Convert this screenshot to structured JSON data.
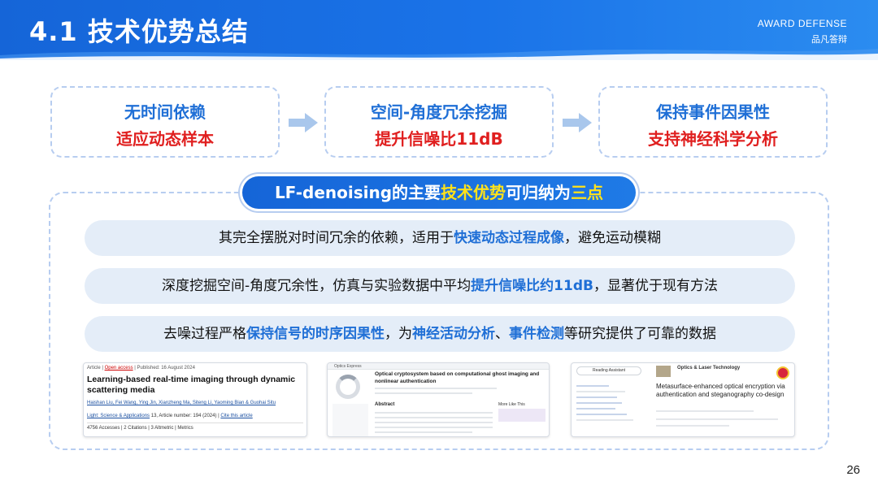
{
  "header": {
    "title": "4.1 技术优势总结",
    "brand_en": "AWARD DEFENSE",
    "brand_cn": "品凡答辩"
  },
  "cards": [
    {
      "line1": "无时间依赖",
      "line2": "适应动态样本"
    },
    {
      "line1": "空间-角度冗余挖掘",
      "line2": "提升信噪比11dB"
    },
    {
      "line1": "保持事件因果性",
      "line2": "支持神经科学分析"
    }
  ],
  "summary": {
    "prefix": "LF-denoising的主要",
    "hl1": "技术优势",
    "mid": "可归纳为",
    "hl2": "三点"
  },
  "points": [
    {
      "a": "其完全摆脱对时间冗余的依赖，适用于",
      "b": "快速动态过程成像",
      "c": "，避免运动模糊"
    },
    {
      "a": "深度挖掘空间-角度冗余性，仿真与实验数据中平均",
      "b": "提升信噪比约11dB",
      "c": "，显著优于现有方法"
    },
    {
      "a": "去噪过程严格",
      "b": "保持信号的时序因果性",
      "c": "，为",
      "d": "神经活动分析",
      "e": "、",
      "f": "事件检测",
      "g": "等研究提供了可靠的数据"
    }
  ],
  "papers": {
    "p1": {
      "article": "Article",
      "open_access": "Open access",
      "published": "Published: 16 August 2024",
      "title": "Learning-based real-time imaging through dynamic scattering media",
      "authors": "Haishan Liu, Fei Wang, Ying Jin, Xianzheng Ma, Siteng Li, Yaoming Bian & Guohai Situ",
      "journal": "Light: Science & Applications",
      "article_number": "13, Article number: 194 (2024)",
      "cite": "Cite this article",
      "stats": "4756 Accesses | 2 Citations | 3 Altmetric | Metrics"
    },
    "p2": {
      "journal": "Optics Express",
      "title": "Optical cryptosystem based on computational ghost imaging and nonlinear authentication",
      "abstract": "Abstract",
      "more": "More Like This"
    },
    "p3": {
      "button": "Reading Assistant",
      "journal": "Optics & Laser Technology",
      "title": "Metasurface-enhanced optical encryption via authentication and steganography co-design"
    }
  },
  "page_number": "26",
  "colors": {
    "header_blue": "#1a73e8",
    "accent_blue": "#1f6fd6",
    "accent_red": "#e01f1f",
    "highlight_yellow": "#ffe21a",
    "point_bg": "#e4edf8"
  }
}
